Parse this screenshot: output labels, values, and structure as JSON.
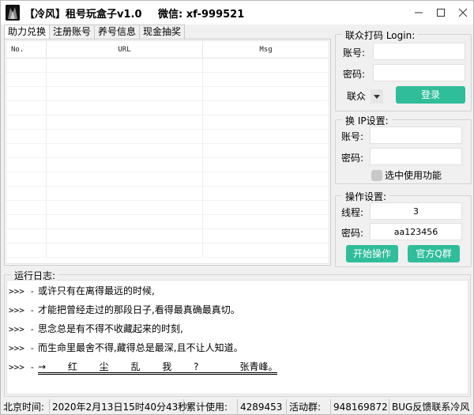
{
  "window": {
    "title": "【冷风】租号玩盒子v1.0",
    "wechat": "微信: xf-999521"
  },
  "tabs": [
    {
      "label": "助力兑换",
      "active": true
    },
    {
      "label": "注册账号",
      "active": false
    },
    {
      "label": "养号信息",
      "active": false
    },
    {
      "label": "现金抽奖",
      "active": false
    }
  ],
  "table": {
    "columns": [
      "No.",
      "URL",
      "Msg"
    ],
    "rows": []
  },
  "login_group": {
    "title": "联众打码 Login:",
    "account_label": "账号:",
    "account_value": "",
    "password_label": "密码:",
    "password_value": "",
    "provider_value": "联众",
    "login_button": "登录"
  },
  "ip_group": {
    "title": "换 IP设置:",
    "account_label": "账号:",
    "account_value": "",
    "password_label": "密码:",
    "password_value": "",
    "checkbox_label": "选中使用功能"
  },
  "ops_group": {
    "title": "操作设置:",
    "threads_label": "线程:",
    "threads_value": "3",
    "password_label": "密码:",
    "password_value": "aa123456",
    "start_button": "开始操作",
    "qq_group_button": "官方Q群"
  },
  "log": {
    "title": "运行日志:",
    "prefix": ">>> -",
    "lines": [
      "或许只有在离得最远的时候,",
      "才能把曾经走过的那段日子,看得最真确最真切。",
      "思念总是有不得不收藏起来的时刻,",
      "而生命里最舍不得,藏得总是最深,且不让人知道。"
    ],
    "last_line": {
      "prefix": ">>> -",
      "text": "→ 红 尘 乱 我 ?",
      "author": "张青峰。"
    }
  },
  "statusbar": {
    "time_label": "北京时间:",
    "time_value": "2020年2月13日15时40分43秒",
    "usage_label": "累计使用:",
    "usage_value": "4289453",
    "group_label": "活动群:",
    "group_value": "948169872",
    "bug_text": "BUG反馈联系冷风"
  }
}
